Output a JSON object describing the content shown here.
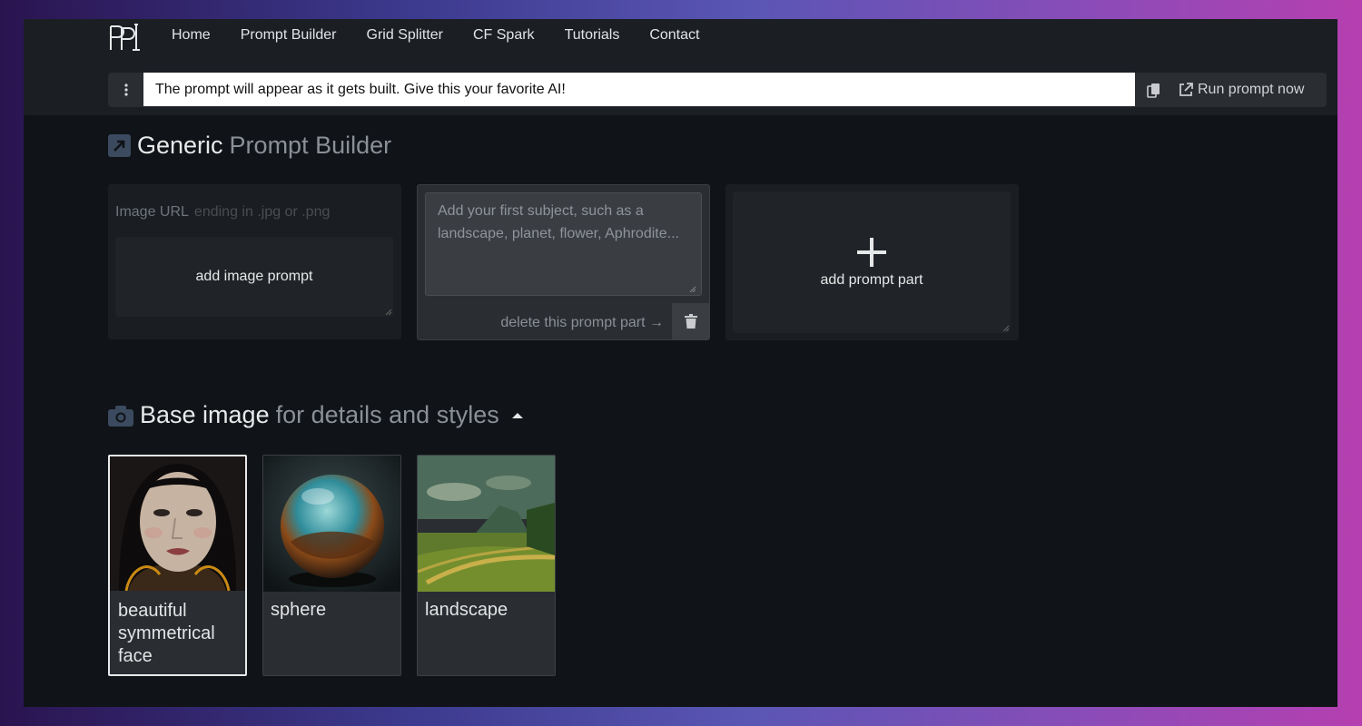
{
  "nav": {
    "logo_text": "PPI",
    "links": [
      "Home",
      "Prompt Builder",
      "Grid Splitter",
      "CF Spark",
      "Tutorials",
      "Contact"
    ]
  },
  "promptbar": {
    "text": "The prompt will appear as it gets built. Give this your favorite AI!",
    "copy_icon": "copy-icon",
    "run_label": "Run prompt now"
  },
  "builder": {
    "title_strong": "Generic",
    "title_muted": "Prompt Builder",
    "image_url_label": "Image URL",
    "image_url_placeholder": "ending in .jpg or .png",
    "image_prompt_label": "add image prompt",
    "subject_placeholder": "Add your first subject, such as a landscape, planet, flower, Aphrodite...",
    "delete_label": "delete this prompt part →",
    "add_part_label": "add prompt part"
  },
  "base_image": {
    "title_strong": "Base image",
    "title_muted": "for details and styles",
    "items": [
      {
        "label": "beautiful symmetrical face",
        "selected": true
      },
      {
        "label": "sphere",
        "selected": false
      },
      {
        "label": "landscape",
        "selected": false
      }
    ]
  },
  "colors": {
    "background": "#101317",
    "topbar": "#1b1e23",
    "accent": "#3b4a5e"
  }
}
